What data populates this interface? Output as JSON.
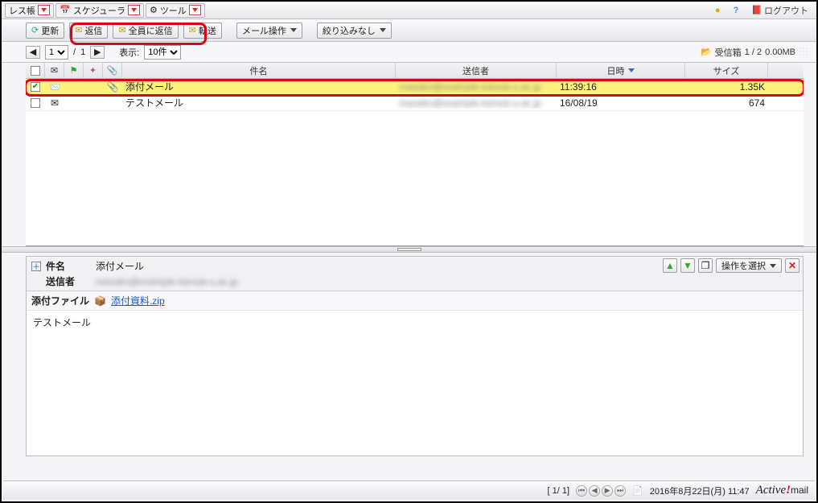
{
  "tabs": {
    "addressbook": "レス帳",
    "scheduler": "スケジューラ",
    "tools": "ツール"
  },
  "topright": {
    "logout": "ログアウト"
  },
  "toolbar": {
    "refresh": "更新",
    "reply": "返信",
    "reply_all": "全員に返信",
    "forward": "転送",
    "mail_ops": "メール操作",
    "filter": "絞り込みなし"
  },
  "paging": {
    "current": "1",
    "total": "1",
    "display_label": "表示:",
    "per_page": "10件"
  },
  "folder": {
    "name": "受信箱",
    "counts": "1 / 2",
    "size": "0.00MB"
  },
  "columns": {
    "subject": "件名",
    "sender": "送信者",
    "date": "日時",
    "size": "サイズ"
  },
  "rows": [
    {
      "subject": "添付メール",
      "sender": "masako@example.kansai-u.ac.jp",
      "date": "11:39:16",
      "size": "1.35K",
      "checked": true,
      "attach": true
    },
    {
      "subject": "テストメール",
      "sender": "masako@example.kansai-u.ac.jp",
      "date": "16/08/19",
      "size": "674",
      "checked": false,
      "attach": false
    }
  ],
  "detail": {
    "subject_label": "件名",
    "subject": "添付メール",
    "sender_label": "送信者",
    "sender": "masako@example.kansai-u.ac.jp",
    "attach_label": "添付ファイル",
    "attach_name": "添付資料.zip",
    "ops_select": "操作を選択",
    "body": "テストメール"
  },
  "footer": {
    "pages": "[ 1/ 1]",
    "datetime": "2016年8月22日(月) 11:47",
    "brand_a": "Active",
    "brand_b": "mail"
  }
}
